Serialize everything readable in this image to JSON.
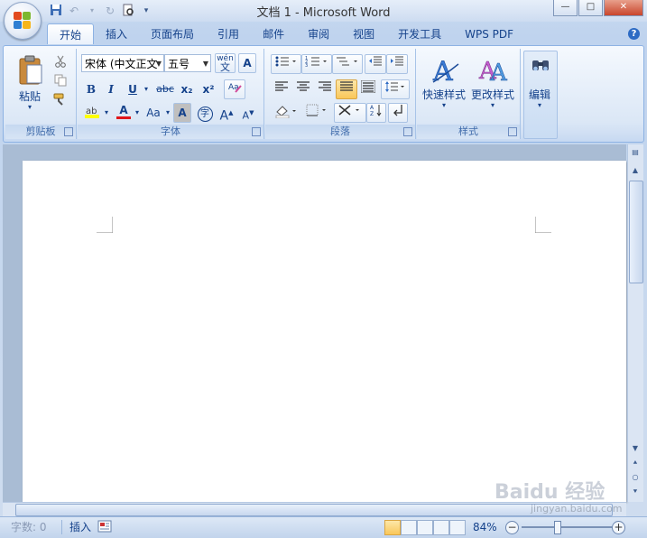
{
  "window": {
    "title": "文档 1 - Microsoft Word",
    "minimize": "—",
    "maximize": "□",
    "close": "✕"
  },
  "colors": {
    "accent": "#15428b",
    "ribbon_border": "#8db2e3",
    "highlight": "#f9c75a"
  },
  "quick_access": {
    "save": "save-icon",
    "undo": "undo-icon",
    "redo": "redo-icon",
    "preview": "print-preview-icon",
    "customize": "customize-icon"
  },
  "tabs": [
    {
      "label": "开始",
      "active": true
    },
    {
      "label": "插入"
    },
    {
      "label": "页面布局"
    },
    {
      "label": "引用"
    },
    {
      "label": "邮件"
    },
    {
      "label": "审阅"
    },
    {
      "label": "视图"
    },
    {
      "label": "开发工具"
    },
    {
      "label": "WPS PDF"
    }
  ],
  "ribbon": {
    "clipboard": {
      "label": "剪贴板",
      "paste": "粘贴"
    },
    "font": {
      "label": "字体",
      "font_name": "宋体 (中文正文",
      "font_size": "五号",
      "bold": "B",
      "italic": "I",
      "underline": "U",
      "strike": "abc",
      "sub": "x₂",
      "sup": "x²",
      "font_color": "A",
      "change_case": "Aa",
      "char_shading": "A",
      "enclose": "字",
      "grow": "A",
      "shrink": "A",
      "phonetic": "wén",
      "phonetic_char": "文",
      "border_char": "A"
    },
    "paragraph": {
      "label": "段落"
    },
    "styles": {
      "label": "样式",
      "quick_styles": "快速样式",
      "change_styles": "更改样式"
    },
    "editing": {
      "label": "编辑",
      "edit": "编辑"
    }
  },
  "status": {
    "word_count": "字数: 0",
    "insert_mode": "插入",
    "zoom": "84%",
    "zoom_level": 0.84
  },
  "watermark": {
    "text": "Baidu 经验",
    "url": "jingyan.baidu.com"
  }
}
